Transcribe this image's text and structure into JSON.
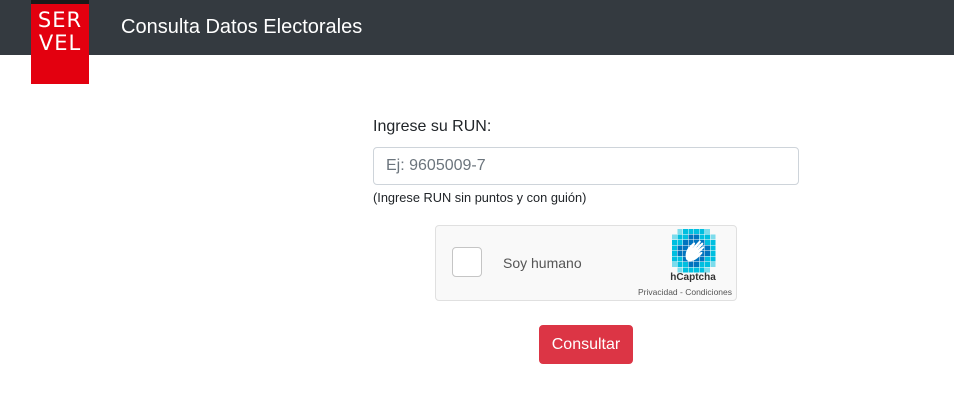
{
  "header": {
    "logo_line1": "SER",
    "logo_line2": "VEL",
    "title": "Consulta Datos Electorales"
  },
  "form": {
    "run_label": "Ingrese su RUN:",
    "run_placeholder": "Ej: 9605009-7",
    "run_value": "",
    "help_text": "(Ingrese RUN sin puntos y con guión)"
  },
  "captcha": {
    "label": "Soy humano",
    "brand": "hCaptcha",
    "privacy_link": "Privacidad",
    "separator": " - ",
    "terms_link": "Condiciones",
    "icon": "hcaptcha-logo-icon"
  },
  "submit": {
    "label": "Consultar"
  },
  "colors": {
    "navbar": "#343a40",
    "logo": "#e3000f",
    "button": "#dc3545",
    "hcaptcha_blue": "#0074bf",
    "hcaptcha_teal": "#00bfe0"
  }
}
